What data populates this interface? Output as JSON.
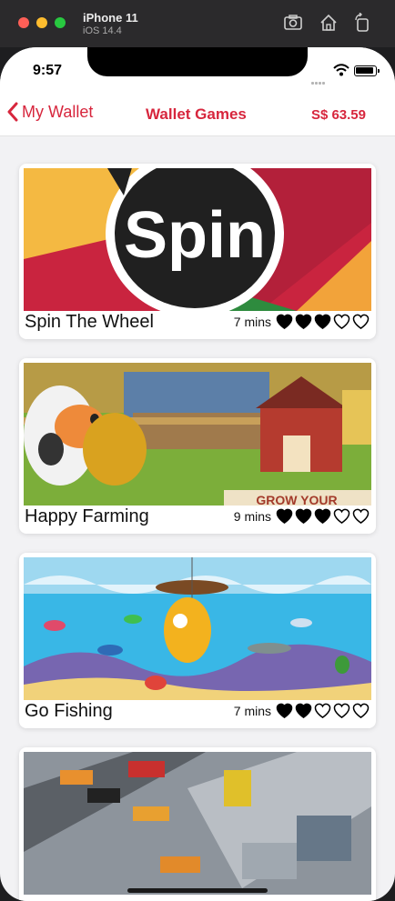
{
  "simulator": {
    "device": "iPhone 11",
    "os": "iOS 14.4"
  },
  "status": {
    "time": "9:57"
  },
  "nav": {
    "back_label": "My Wallet",
    "title": "Wallet Games",
    "balance": "S$ 63.59"
  },
  "games": [
    {
      "name": "Spin The Wheel",
      "duration": "7 mins",
      "rating": 3,
      "image_text": "Spin"
    },
    {
      "name": "Happy Farming",
      "duration": "9 mins",
      "rating": 3,
      "image_text": "GROW YOUR"
    },
    {
      "name": "Go Fishing",
      "duration": "7 mins",
      "rating": 2,
      "image_text": ""
    },
    {
      "name": "",
      "duration": "",
      "rating": 0,
      "image_text": ""
    }
  ],
  "colors": {
    "accent": "#d7263d",
    "background": "#f2f2f4"
  }
}
